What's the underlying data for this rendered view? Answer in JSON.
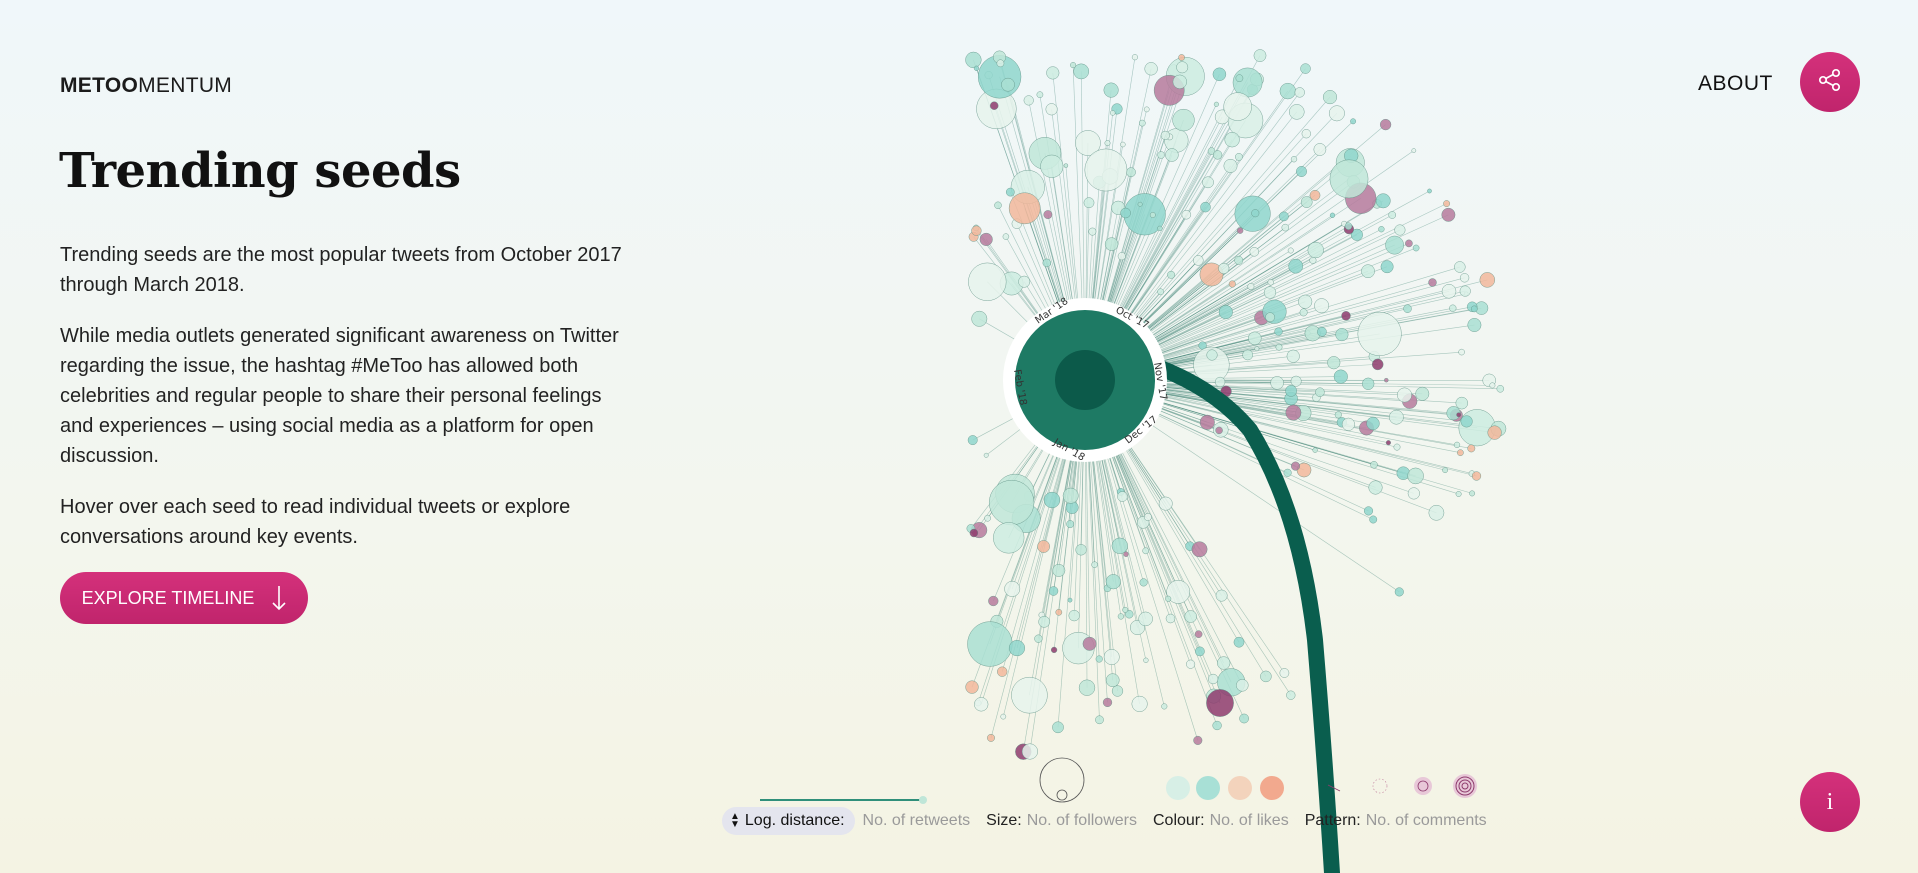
{
  "header": {
    "brand_bold": "METOO",
    "brand_regular": "MENTUM",
    "about_label": "ABOUT",
    "share_icon": "share-icon",
    "info_label": "i"
  },
  "intro": {
    "title": "Trending seeds",
    "paragraphs": [
      "Trending seeds are the most popular tweets from October 2017 through March 2018.",
      "While media outlets generated significant awareness on Twitter regarding the issue, the hashtag #MeToo has allowed both celebrities and regular people to share their personal feelings and experiences – using social media as a platform for open discussion.",
      "Hover over each seed to read individual tweets or explore conversations around key events."
    ],
    "cta_label": "EXPLORE TIMELINE",
    "cta_icon": "arrow-down-icon"
  },
  "dial": {
    "months": [
      "Oct '17",
      "Nov '17",
      "Dec '17",
      "Jan '18",
      "Feb '18",
      "Mar '18"
    ]
  },
  "legend": {
    "distance_key": "Log. distance:",
    "distance_val": "No. of retweets",
    "size_key": "Size:",
    "size_val": "No. of followers",
    "colour_key": "Colour:",
    "colour_val": "No. of likes",
    "pattern_key": "Pattern:",
    "pattern_val": "No. of comments"
  },
  "colors": {
    "accent": "#cc2a73",
    "stem": "#0a5e4e",
    "seed_light": "#bfe6d8",
    "seed_teal": "#8fd6cc",
    "seed_peach": "#f2b79b",
    "seed_plum": "#8e3b6d"
  }
}
